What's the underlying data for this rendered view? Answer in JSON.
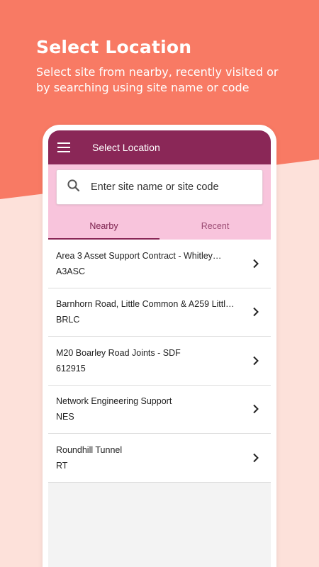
{
  "promo": {
    "title": "Select Location",
    "subtitle": "Select site from nearby, recently visited or by searching using site name or code"
  },
  "appbar": {
    "title": "Select Location",
    "menu_icon": "hamburger-menu-icon"
  },
  "search": {
    "placeholder": "Enter site name or site code",
    "icon": "search-icon"
  },
  "tabs": [
    {
      "label": "Nearby",
      "active": true
    },
    {
      "label": "Recent",
      "active": false
    }
  ],
  "sites": [
    {
      "name": "Area 3 Asset Support Contract - Whitley…",
      "code": "A3ASC"
    },
    {
      "name": "Barnhorn Road, Little Common & A259 Littl…",
      "code": "BRLC"
    },
    {
      "name": "M20 Boarley Road Joints - SDF",
      "code": "612915"
    },
    {
      "name": "Network Engineering Support",
      "code": "NES"
    },
    {
      "name": "Roundhill Tunnel",
      "code": "RT"
    }
  ],
  "colors": {
    "coral": "#f87a64",
    "light_pink_bg": "#fde1da",
    "appbar": "#8a2757",
    "tab_bg": "#f8c4dc"
  }
}
